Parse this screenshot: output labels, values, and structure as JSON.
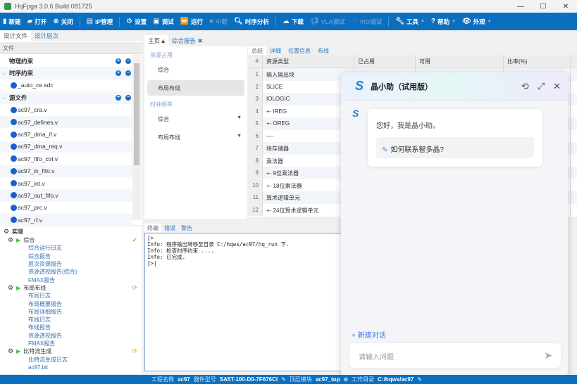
{
  "window": {
    "title": "HqFpga 3.0.6 Build 081725",
    "min": "—",
    "max": "☐",
    "close": "✕"
  },
  "toolbar": [
    {
      "label": "新建",
      "icon": "▮",
      "state": "enabled"
    },
    {
      "label": "打开",
      "icon": "▰",
      "state": "enabled"
    },
    {
      "label": "关闭",
      "icon": "⊗",
      "state": "enabled"
    },
    {
      "label": "IP管理",
      "icon": "▤",
      "state": "enabled",
      "sep_before": true
    },
    {
      "label": "设置",
      "icon": "⚙",
      "state": "enabled",
      "sep_before": true
    },
    {
      "label": "调试",
      "icon": "▣",
      "state": "enabled"
    },
    {
      "label": "运行",
      "icon": "⏩",
      "state": "enabled"
    },
    {
      "label": "中断",
      "icon": "■",
      "state": "disabled"
    },
    {
      "label": "时序分析",
      "icon": "🔍︎",
      "state": "enabled"
    },
    {
      "label": "下载",
      "icon": "☁",
      "state": "enabled",
      "sep_before": true
    },
    {
      "label": "VLA调试",
      "icon": "📢︎",
      "state": "disabled"
    },
    {
      "label": "VIO调试",
      "icon": "☞",
      "state": "disabled"
    },
    {
      "label": "工具",
      "icon": "🔧︎",
      "state": "enabled",
      "sep_before": true,
      "dropdown": true
    },
    {
      "label": "帮助",
      "icon": "?",
      "state": "enabled",
      "dropdown": true
    },
    {
      "label": "外观",
      "icon": "👁︎",
      "state": "enabled",
      "dropdown": true
    }
  ],
  "left": {
    "tabs": [
      "设计文件",
      "设计层次"
    ],
    "active_tab": 0,
    "column": "文件",
    "tree": [
      {
        "label": "物理约束",
        "type": "group",
        "expand": false,
        "add_remove": true
      },
      {
        "label": "时序约束",
        "type": "group",
        "expand": true,
        "add_remove": true
      },
      {
        "label": "_auto_ce.sdc",
        "type": "file"
      },
      {
        "label": "源文件",
        "type": "group",
        "expand": true,
        "add_remove": true
      },
      {
        "label": "ac97_cra.v",
        "type": "file"
      },
      {
        "label": "ac97_defines.v",
        "type": "file"
      },
      {
        "label": "ac97_dma_if.v",
        "type": "file"
      },
      {
        "label": "ac97_dma_req.v",
        "type": "file"
      },
      {
        "label": "ac97_fifo_ctrl.v",
        "type": "file"
      },
      {
        "label": "ac97_in_fifo.v",
        "type": "file"
      },
      {
        "label": "ac97_int.v",
        "type": "file"
      },
      {
        "label": "ac97_out_fifo.v",
        "type": "file"
      },
      {
        "label": "ac97_prc.v",
        "type": "file"
      },
      {
        "label": "ac97_rf.v",
        "type": "file"
      }
    ]
  },
  "impl": {
    "title": "实现",
    "steps": [
      {
        "label": "综合",
        "status": "done",
        "status_icon": "✔",
        "links": [
          "综合运行日志",
          "综合报告",
          "层次资源报告",
          "资源透视报告(综合)",
          "FMAX报告"
        ]
      },
      {
        "label": "布局布线",
        "status": "pending",
        "status_icon": "⟳",
        "links": [
          "布局日志",
          "布局概要报告",
          "布局详细报告",
          "布线日志",
          "布线报告",
          "资源透视报告",
          "FMAX报告"
        ]
      },
      {
        "label": "比特流生成",
        "status": "pending",
        "status_icon": "⟳",
        "links": [
          "比特流生成日志",
          "ac97.bit"
        ]
      }
    ]
  },
  "center": {
    "tabs": [
      {
        "label": "主页",
        "icon": "🔒︎"
      },
      {
        "label": "综合报告",
        "icon": "✖"
      }
    ],
    "active_tab": 0,
    "nav": {
      "sections": [
        {
          "title": "资源占用",
          "items": [
            "综合",
            "布局布线"
          ],
          "selected": 1
        },
        {
          "title": "时钟频率",
          "items": [
            "综合",
            "布局布线"
          ]
        }
      ]
    },
    "subtabs": [
      "总结",
      "详细",
      "位置信息",
      "布线"
    ],
    "active_subtab": 0,
    "table": {
      "headers": [
        "#",
        "资源类型",
        "已占用",
        "可用",
        "比率(%)"
      ],
      "rows": [
        [
          "1",
          "输入输出块"
        ],
        [
          "2",
          "SLICE"
        ],
        [
          "3",
          "IOLOGIC"
        ],
        [
          "4",
          "+- IREG"
        ],
        [
          "5",
          "+- OREG"
        ],
        [
          "6",
          "----"
        ],
        [
          "7",
          "块存储器"
        ],
        [
          "8",
          "乘法器"
        ],
        [
          "9",
          "+- 9位乘法器"
        ],
        [
          "10",
          "+- 18位乘法器"
        ],
        [
          "11",
          "算术逻辑单元"
        ],
        [
          "12",
          "+- 24位算术逻辑单元"
        ]
      ]
    }
  },
  "console": {
    "tabs": [
      "终端",
      "错误",
      "警告"
    ],
    "active_tab": 0,
    "lines": [
      "[>",
      "Info: 程序输出转移至目录 C:/hqws/ac97/hq_run 下.",
      "Info: 检查时序约束 ....",
      "Info: 已完成.",
      "[>|"
    ]
  },
  "chat": {
    "title": "晶小助（试用版）",
    "greeting": "您好，我是晶小助。",
    "suggestion": "如何联系智多晶?",
    "new_chat": "+ 新建对话",
    "input_placeholder": "请输入问题"
  },
  "status": {
    "project_label": "工程名称",
    "project": "ac97",
    "device_label": "器件型号",
    "device": "SA5T-100-D0-7F676CI",
    "top_label": "顶层模块",
    "top": "ac97_top",
    "dir_label": "工作目录",
    "dir": "C:/hqws/ac97"
  },
  "colors": {
    "toolbar": "#0b6fc0",
    "link": "#2f7ac0",
    "accent": "#4a78e8"
  }
}
